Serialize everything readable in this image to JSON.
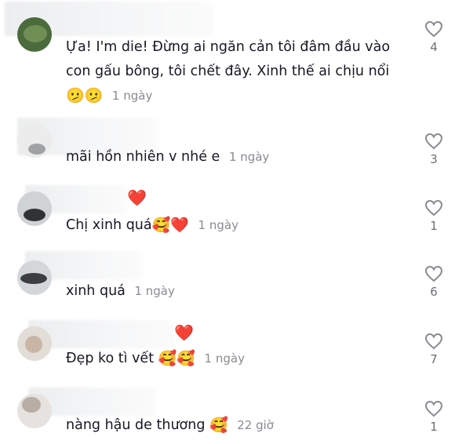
{
  "comments": [
    {
      "text": "Ựa! I'm die! Đừng ai ngăn cản tôi đâm đầu vào con gấu bông, tôi chết đây. Xinh thế ai chịu nổi",
      "emojis": "🫤🫤",
      "date": "1 ngày",
      "likes": "4"
    },
    {
      "text": "mãi hồn nhiên v nhé e",
      "emojis": "",
      "date": "1 ngày",
      "likes": "3"
    },
    {
      "text": "Chị xinh quá",
      "emojis": "🥰❤️",
      "name_emoji": "❤️",
      "date": "1 ngày",
      "likes": "1"
    },
    {
      "text": "xinh quá",
      "emojis": "",
      "date": "1 ngày",
      "likes": "6"
    },
    {
      "text": "Đẹp ko tì vết",
      "emojis": "🥰🥰",
      "name_emoji": "❤️",
      "date": "1 ngày",
      "likes": "7"
    },
    {
      "text": "nàng hậu de thương",
      "emojis": "🥰",
      "date": "22 giờ",
      "likes": "1"
    }
  ],
  "icons": {
    "like": "heart-outline-icon"
  },
  "colors": {
    "date": "#8a8b91",
    "heart": "#e8112d",
    "like_outline": "#8a8b91"
  }
}
